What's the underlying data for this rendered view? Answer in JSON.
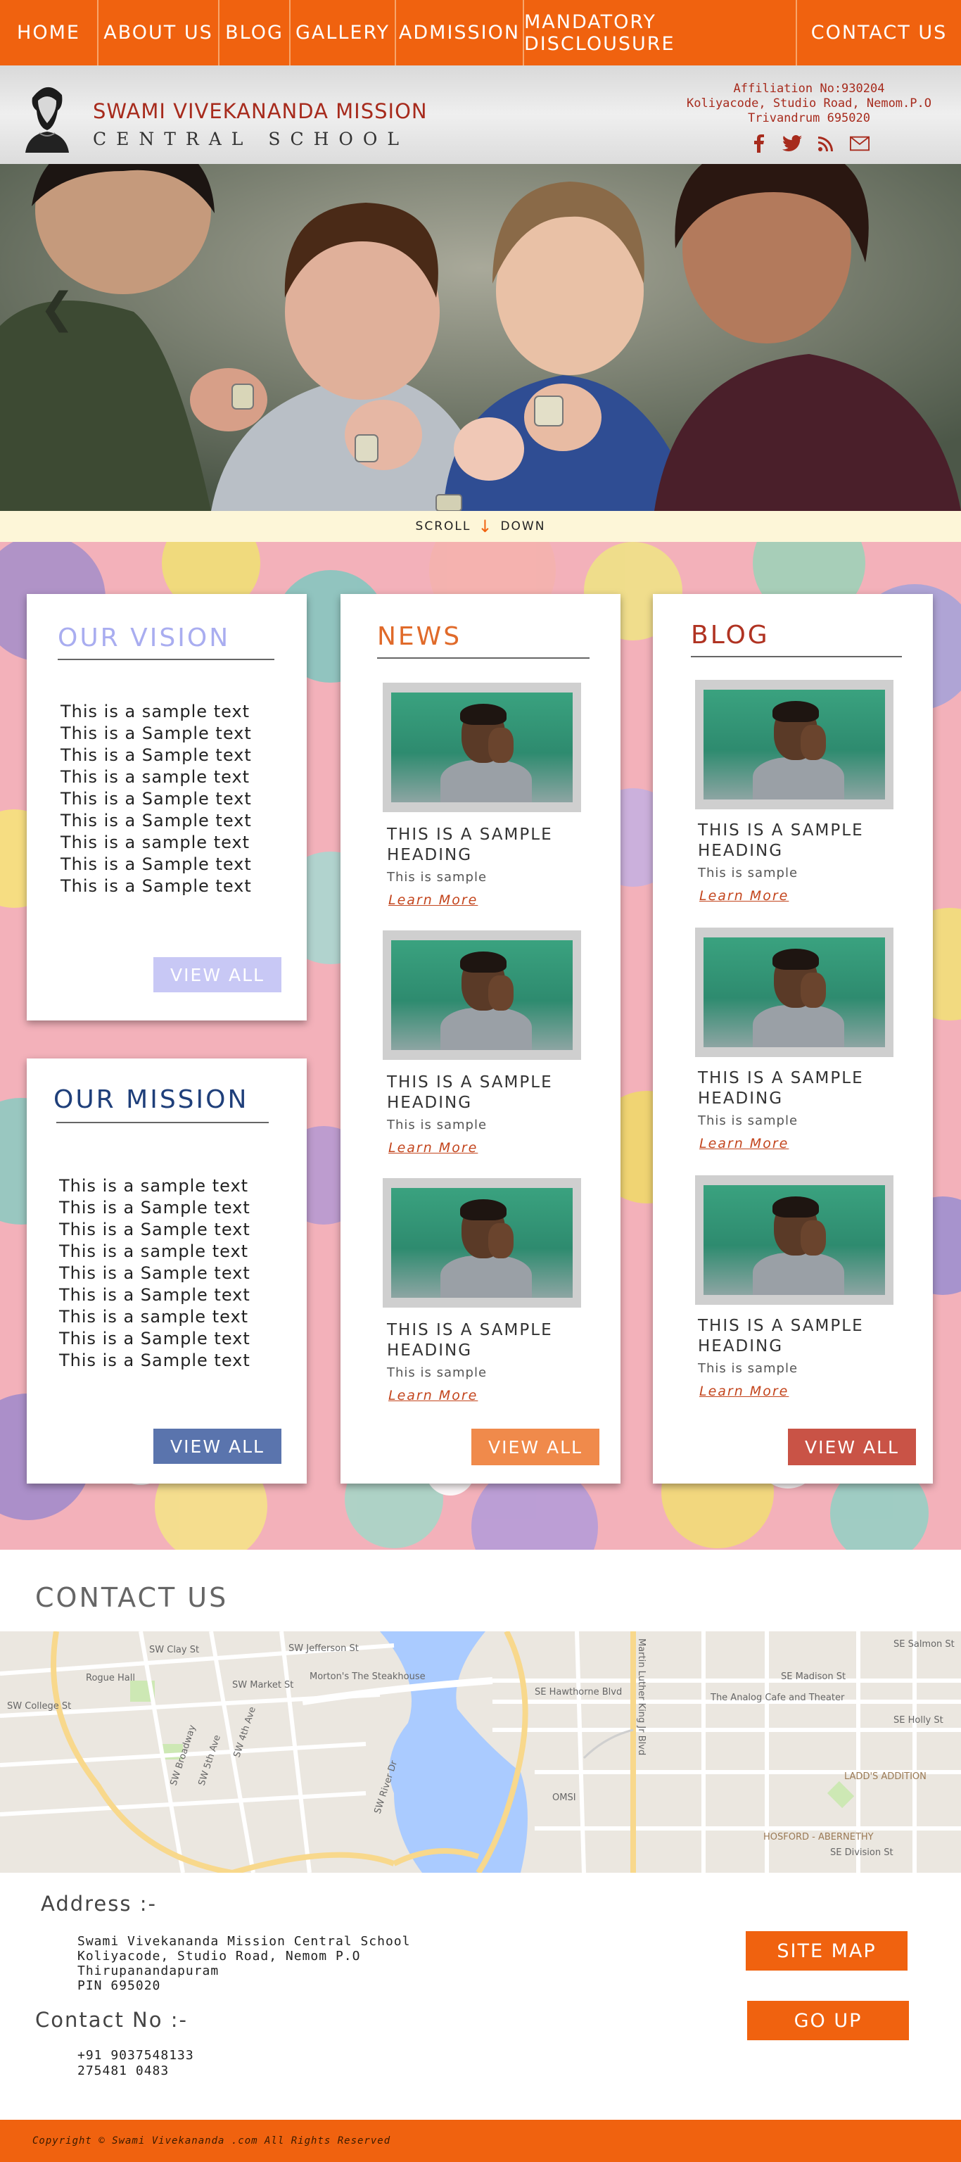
{
  "nav": [
    "HOME",
    "ABOUT US",
    "BLOG",
    "GALLERY",
    "ADMISSION",
    "MANDATORY DISCLOUSURE",
    "CONTACT US"
  ],
  "header": {
    "name_line1": "SWAMI VIVEKANANDA MISSION",
    "name_line2": "CENTRAL SCHOOL",
    "affiliation": "Affiliation No:930204",
    "address": "Koliyacode, Studio Road, Nemom.P.O",
    "city": "Trivandrum 695020",
    "socials": [
      "facebook-icon",
      "twitter-icon",
      "rss-icon",
      "mail-icon"
    ]
  },
  "hero": {
    "prev": "❮"
  },
  "scroll": {
    "left": "SCROLL",
    "arrow": "↓",
    "right": "DOWN"
  },
  "vision": {
    "title": "OUR VISION",
    "lines": [
      "This is a sample text",
      "This is a Sample text",
      "This is a Sample text",
      "This is a sample text",
      "This is a Sample text",
      "This is a Sample text",
      "This is a sample text",
      "This is a Sample text",
      "This is a Sample text"
    ],
    "button": "VIEW ALL"
  },
  "mission": {
    "title": "OUR MISSION",
    "lines": [
      "This is a sample text",
      "This is a Sample text",
      "This is a Sample text",
      "This is a sample text",
      "This is a Sample text",
      "This is a Sample text",
      "This is a sample text",
      "This is a Sample text",
      "This is a Sample text"
    ],
    "button": "VIEW ALL"
  },
  "news": {
    "title": "NEWS",
    "posts": [
      {
        "heading1": "THIS IS A SAMPLE",
        "heading2": "HEADING",
        "sub": "This is sample",
        "link": "Learn More"
      },
      {
        "heading1": "THIS IS A SAMPLE",
        "heading2": "HEADING",
        "sub": "This is sample",
        "link": "Learn More"
      },
      {
        "heading1": "THIS IS A SAMPLE",
        "heading2": "HEADING",
        "sub": "This is sample",
        "link": "Learn More"
      }
    ],
    "button": "VIEW ALL"
  },
  "blog": {
    "title": "BLOG",
    "posts": [
      {
        "heading1": "THIS IS A SAMPLE",
        "heading2": "HEADING",
        "sub": "This is sample",
        "link": "Learn More"
      },
      {
        "heading1": "THIS IS A SAMPLE",
        "heading2": "HEADING",
        "sub": "This is sample",
        "link": "Learn More"
      },
      {
        "heading1": "THIS IS A SAMPLE",
        "heading2": "HEADING",
        "sub": "This is sample",
        "link": "Learn More"
      }
    ],
    "button": "VIEW ALL"
  },
  "contact": {
    "title": "CONTACT US",
    "map_labels": [
      "SW Clay St",
      "SW Jefferson St",
      "Rogue Hall",
      "SW Market St",
      "Morton's The Steakhouse",
      "SW College St",
      "SW Broadway",
      "SW 5th Ave",
      "SW 4th Ave",
      "SW River Dr",
      "OMSI",
      "SE Hawthorne Blvd",
      "SE Madison St",
      "The Analog Cafe and Theater",
      "SE Salmon St",
      "SE Holly St",
      "LADD'S ADDITION",
      "HOSFORD - ABERNETHY",
      "Martin Luther King Jr Blvd",
      "SE Division St"
    ],
    "address_title": "Address :-",
    "address_lines": [
      "Swami Vivekananda Mission Central School",
      "Koliyacode, Studio Road, Nemom P.O",
      "Thirupanandapuram",
      "PIN 695020"
    ],
    "phone_title": "Contact No :-",
    "phone_lines": [
      "+91 9037548133",
      "275481 0483"
    ],
    "site_map": "SITE MAP",
    "go_up": "GO UP"
  },
  "footer": {
    "copyright": "Copyright © Swami Vivekananda .com All Rights Reserved"
  },
  "colors": {
    "accent": "#f0620f",
    "brand_red": "#a72b1d",
    "vision": "#c8c8f5",
    "mission": "#5a74ad",
    "news": "#f08a4b",
    "blog": "#c95346"
  }
}
